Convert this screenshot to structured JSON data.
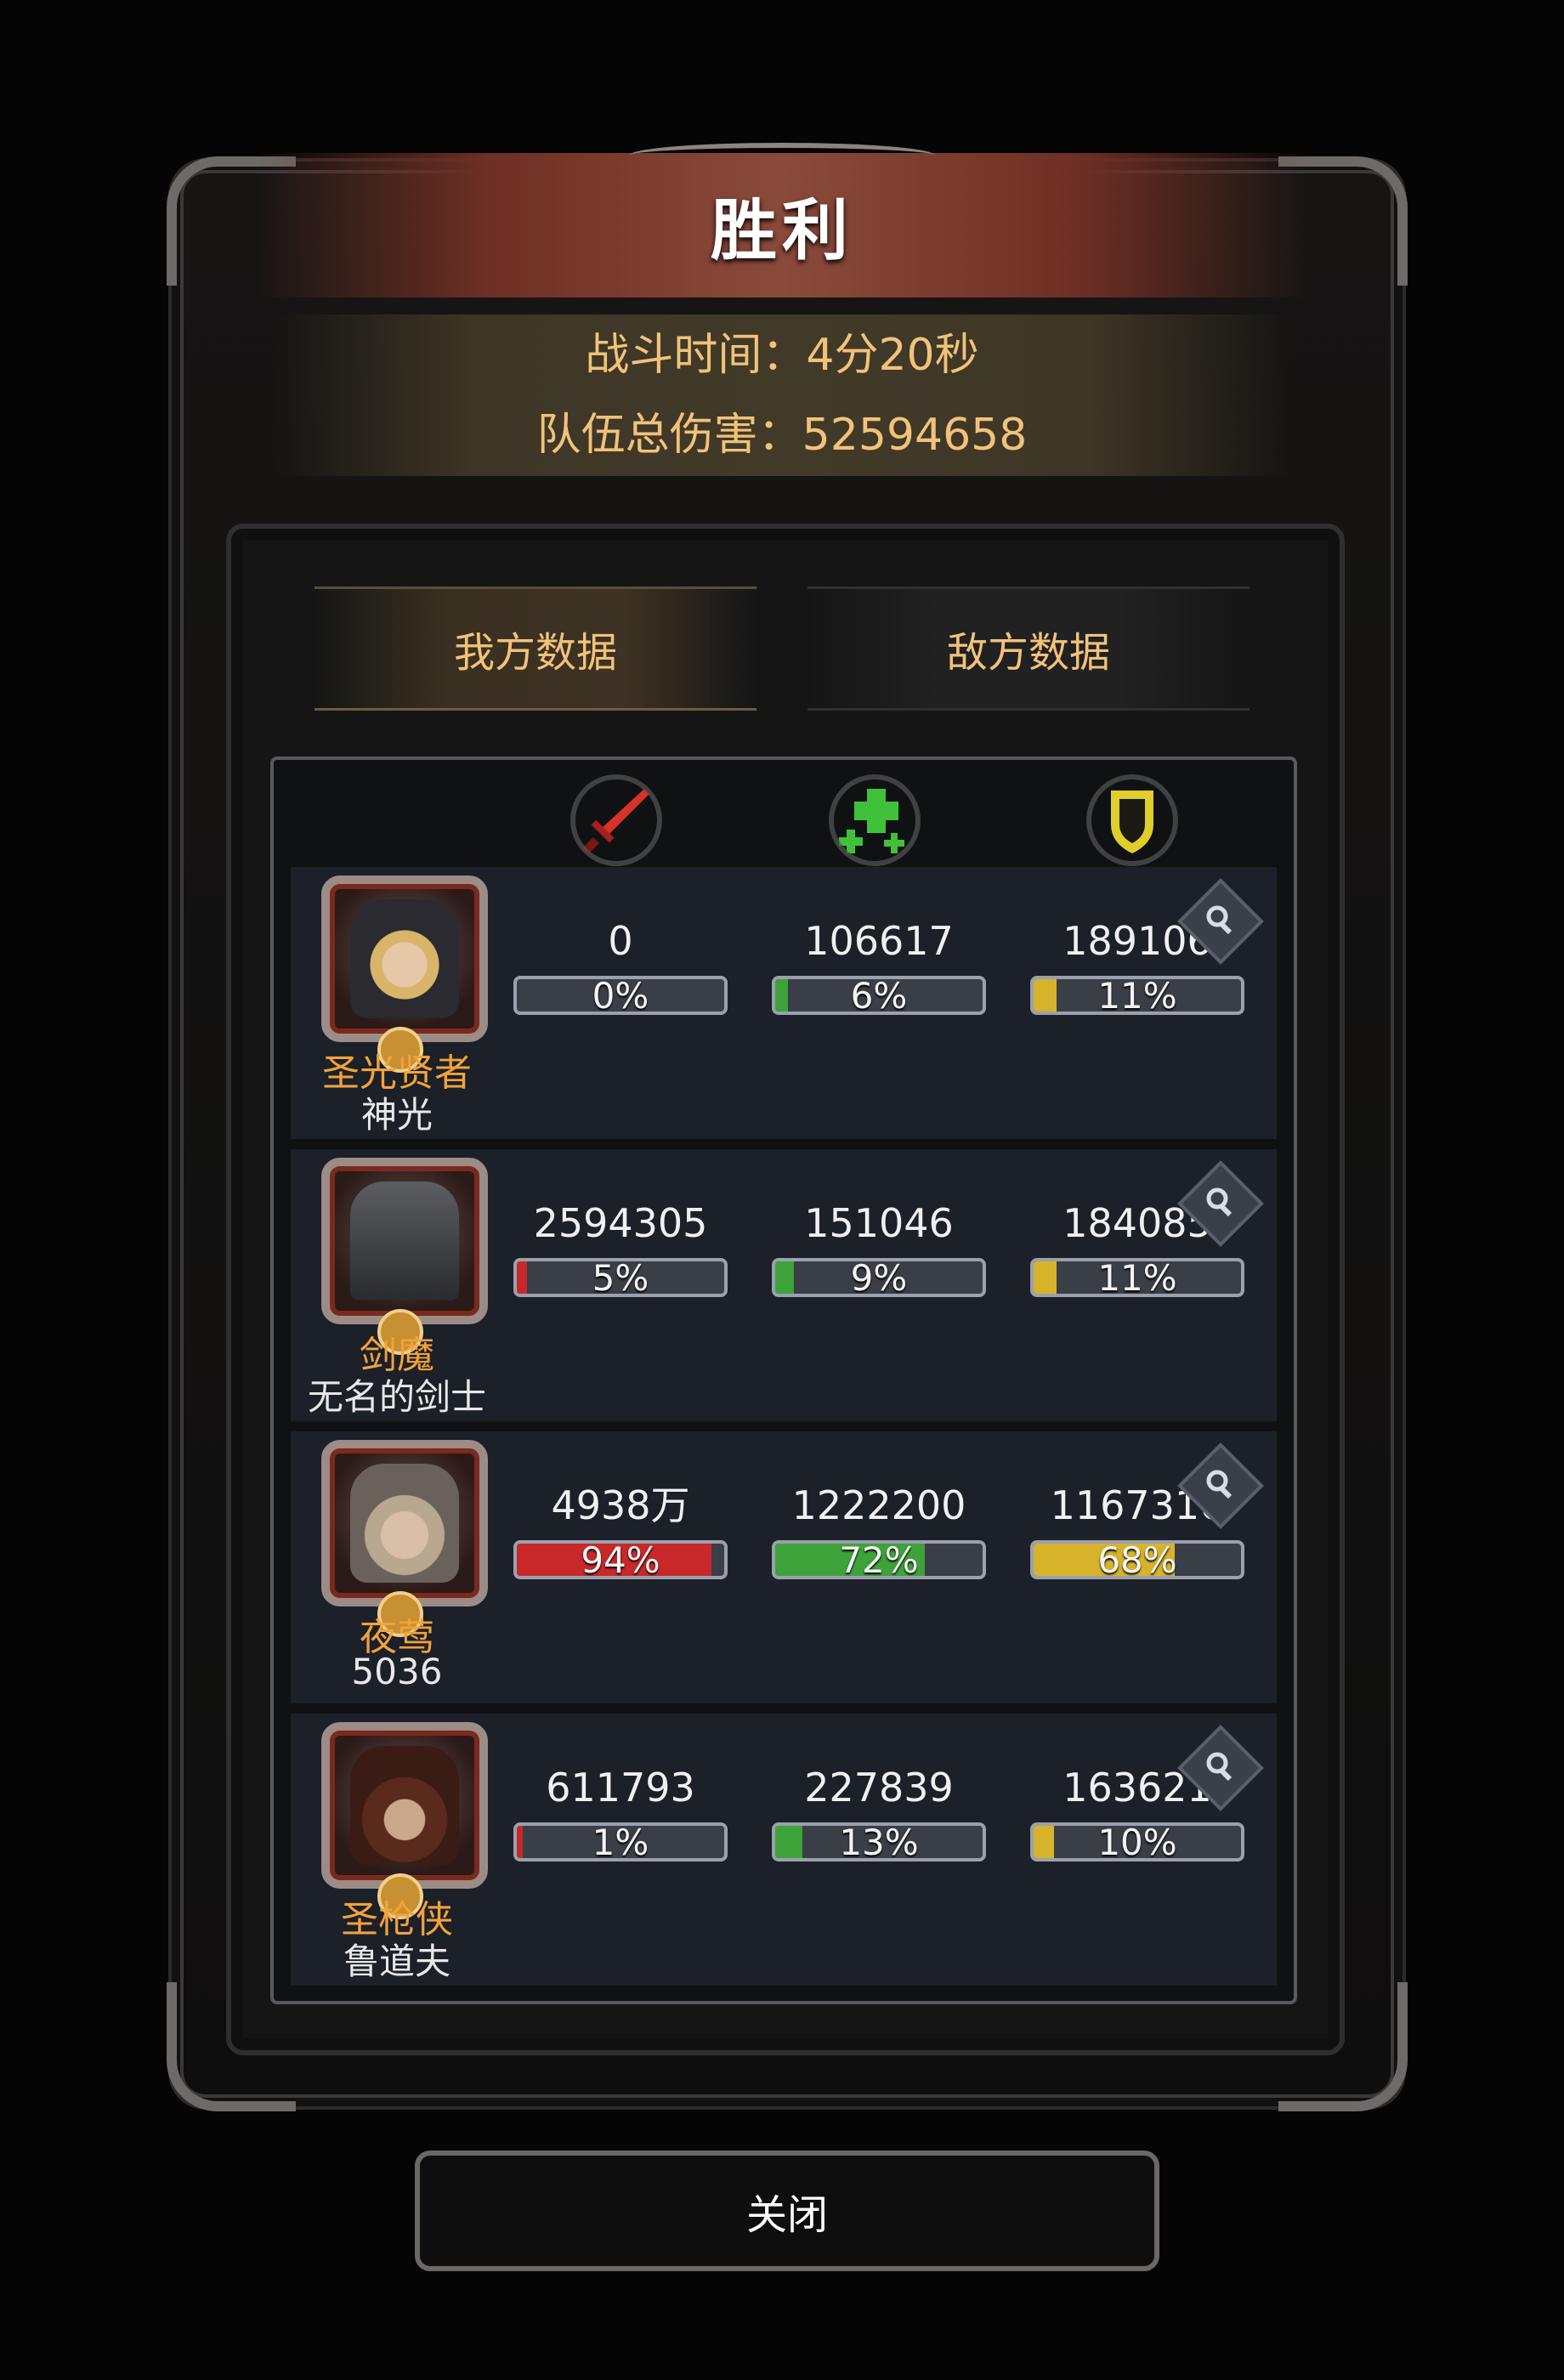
{
  "header": {
    "title": "胜利",
    "battle_time": "战斗时间：4分20秒",
    "team_damage": "队伍总伤害：52594658"
  },
  "tabs": [
    {
      "label": "我方数据",
      "active": true
    },
    {
      "label": "敌方数据",
      "active": false
    }
  ],
  "columns": [
    {
      "icon": "sword-icon",
      "color": "#d9302a"
    },
    {
      "icon": "heal-cross-icon",
      "color": "#3fc23a"
    },
    {
      "icon": "shield-icon",
      "color": "#e0cf2a"
    }
  ],
  "rows": [
    {
      "hero_class": "圣光贤者",
      "hero_name": "神光",
      "damage": "0",
      "damage_pct": "0%",
      "damage_frac": 0.0,
      "heal": "106617",
      "heal_pct": "6%",
      "heal_frac": 0.06,
      "tank": "189106",
      "tank_pct": "11%",
      "tank_frac": 0.11
    },
    {
      "hero_class": "剑魔",
      "hero_name": "无名的剑士",
      "damage": "2594305",
      "damage_pct": "5%",
      "damage_frac": 0.05,
      "heal": "151046",
      "heal_pct": "9%",
      "heal_frac": 0.09,
      "tank": "184085",
      "tank_pct": "11%",
      "tank_frac": 0.11
    },
    {
      "hero_class": "夜莺",
      "hero_name": "5036",
      "damage": "4938万",
      "damage_pct": "94%",
      "damage_frac": 0.94,
      "heal": "1222200",
      "heal_pct": "72%",
      "heal_frac": 0.72,
      "tank": "1167316",
      "tank_pct": "68%",
      "tank_frac": 0.68
    },
    {
      "hero_class": "圣枪侠",
      "hero_name": "鲁道夫",
      "damage": "611793",
      "damage_pct": "1%",
      "damage_frac": 0.01,
      "heal": "227839",
      "heal_pct": "13%",
      "heal_frac": 0.13,
      "tank": "163621",
      "tank_pct": "10%",
      "tank_frac": 0.1
    }
  ],
  "colors": {
    "damage_fill": "#c8282a",
    "heal_fill": "#3ea23a",
    "tank_fill": "#d6b32a",
    "accent_gold": "#f2c27a"
  },
  "close_label": "关闭"
}
